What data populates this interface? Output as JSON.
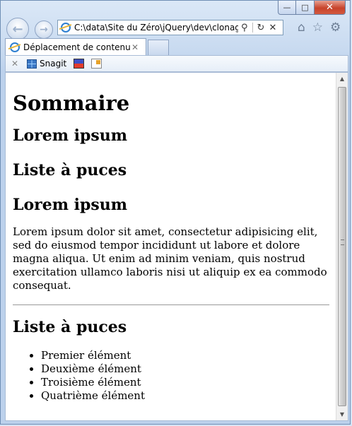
{
  "browser": {
    "window_controls": {
      "minimize": "—",
      "maximize": "□",
      "close": "✕"
    },
    "nav": {
      "back_icon": "arrow-left-icon",
      "forward_icon": "arrow-right-icon"
    },
    "address": {
      "value": "C:\\data\\Site du Zéro\\jQuery\\dev\\clonage-c",
      "tools": {
        "search": "⚲",
        "refresh": "↻",
        "stop": "✕"
      }
    },
    "right_tools": {
      "home": "⌂",
      "favorites": "☆",
      "settings": "⚙"
    },
    "tab": {
      "title": "Déplacement de contenu",
      "close": "✕"
    },
    "toolbar": {
      "close": "✕",
      "snagit_label": "Snagit"
    }
  },
  "page": {
    "h1": "Sommaire",
    "h2_a": "Lorem ipsum",
    "h2_b": "Liste à puces",
    "h2_c": "Lorem ipsum",
    "paragraph": "Lorem ipsum dolor sit amet, consectetur adipisicing elit, sed do eiusmod tempor incididunt ut labore et dolore magna aliqua. Ut enim ad minim veniam, quis nostrud exercitation ullamco laboris nisi ut aliquip ex ea commodo consequat.",
    "h2_d": "Liste à puces",
    "list": [
      "Premier élément",
      "Deuxième élément",
      "Troisième élément",
      "Quatrième élément"
    ]
  },
  "scrollbar": {
    "up": "▲",
    "down": "▼"
  }
}
